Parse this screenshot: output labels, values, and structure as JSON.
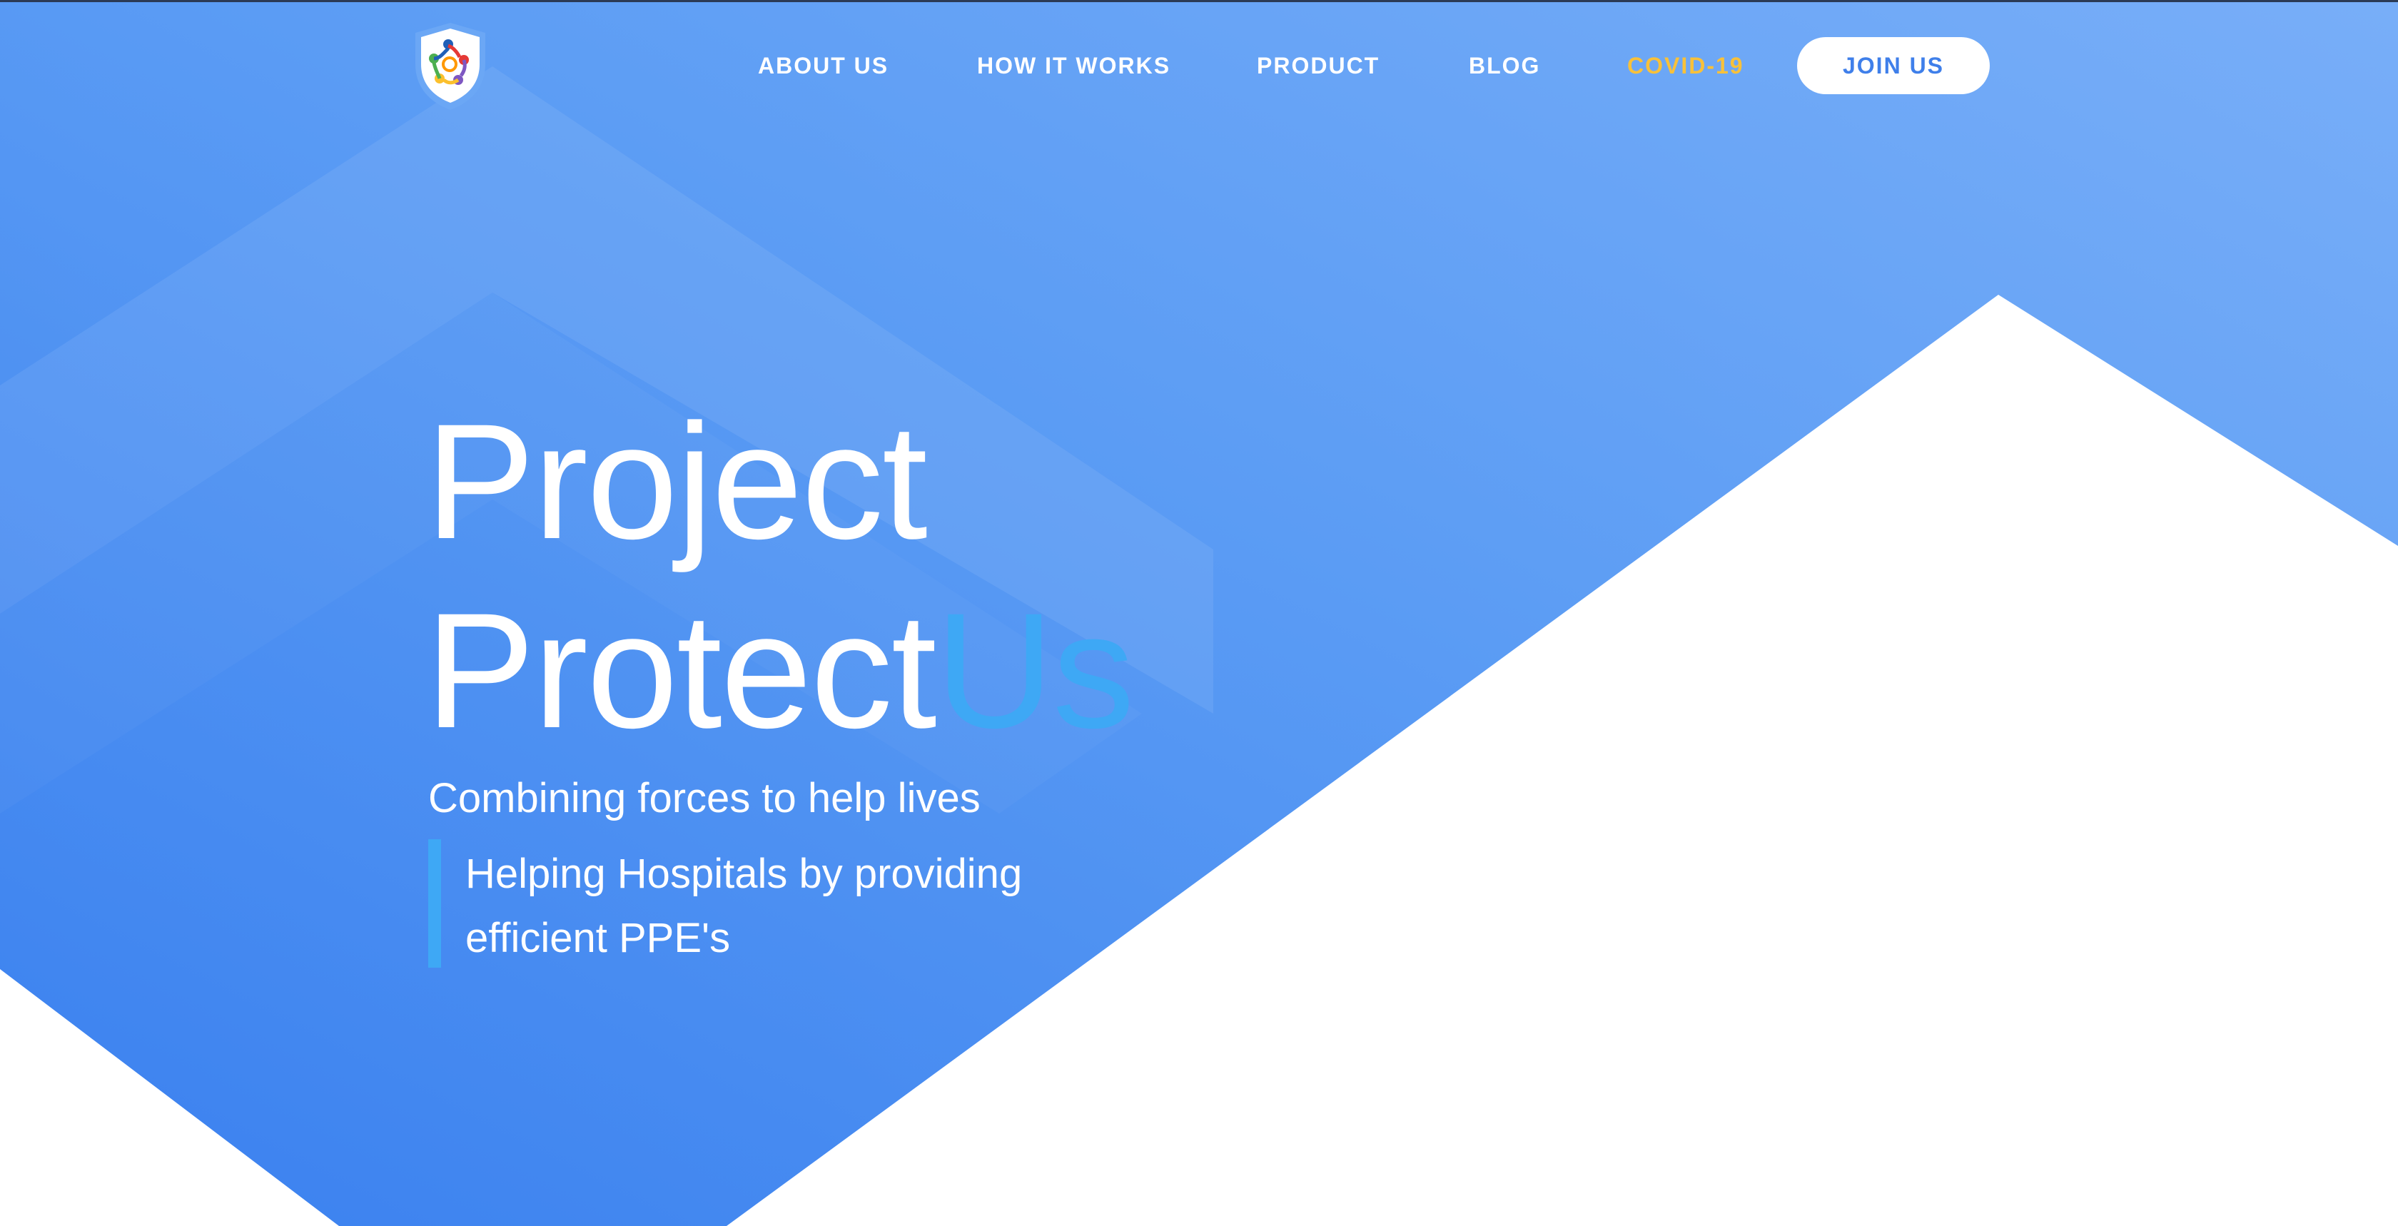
{
  "nav": {
    "about": "ABOUT US",
    "how_it_works": "HOW IT WORKS",
    "product": "PRODUCT",
    "blog": "BLOG",
    "covid": "COVID-19",
    "join": "JOIN US"
  },
  "hero": {
    "line1": "Project",
    "line2_main": "Protect",
    "line2_accent": "Us",
    "subheading": "Combining forces to help lives",
    "quote": "Helping Hospitals by providing efficient PPE's"
  },
  "logo": {
    "icon": "shield-people-logo-icon"
  },
  "colors": {
    "hero_blue_start": "#3f86f0",
    "hero_blue_end": "#74aaf7",
    "accent_blue": "#3ea8f5",
    "covid_yellow": "#f8c13a",
    "button_text": "#3f7fea",
    "white": "#ffffff"
  }
}
